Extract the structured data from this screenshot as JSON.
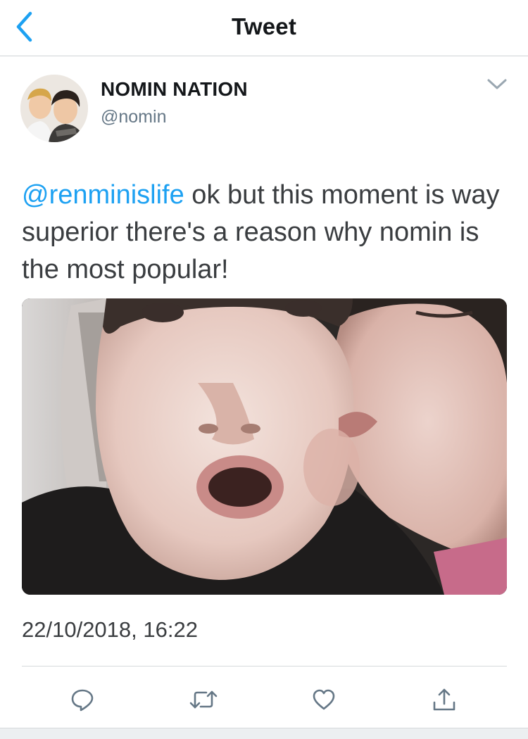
{
  "navbar": {
    "title": "Tweet",
    "back_icon": "chevron-left-icon"
  },
  "author": {
    "display_name": "NOMIN NATION",
    "handle": "@nomin",
    "avatar_icon": "profile-photo"
  },
  "tweet": {
    "mention": "@renminislife",
    "text": " ok but this moment is way superior there's a reason why nomin is the most popular!",
    "media_description_icon": "photo",
    "timestamp": "22/10/2018, 16:22"
  },
  "actions": [
    {
      "name": "reply",
      "icon": "reply-icon"
    },
    {
      "name": "retweet",
      "icon": "retweet-icon"
    },
    {
      "name": "like",
      "icon": "heart-icon"
    },
    {
      "name": "share",
      "icon": "share-icon"
    }
  ],
  "colors": {
    "accent": "#1da1f2",
    "icon_gray": "#657786",
    "text": "#14171a"
  }
}
